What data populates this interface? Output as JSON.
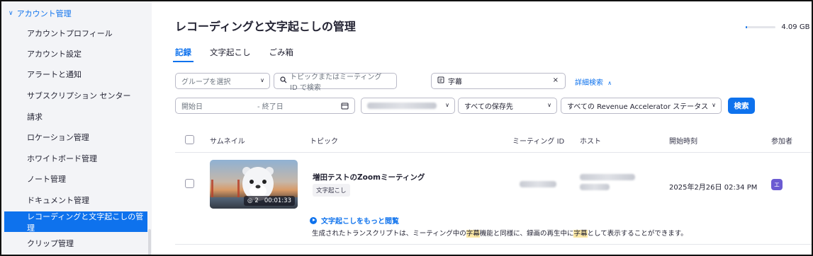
{
  "sidebar": {
    "section_label": "アカウント管理",
    "items": [
      {
        "label": "アカウントプロフィール",
        "active": false
      },
      {
        "label": "アカウント設定",
        "active": false
      },
      {
        "label": "アラートと通知",
        "active": false
      },
      {
        "label": "サブスクリプション センター",
        "active": false
      },
      {
        "label": "請求",
        "active": false
      },
      {
        "label": "ロケーション管理",
        "active": false
      },
      {
        "label": "ホワイトボード管理",
        "active": false
      },
      {
        "label": "ノート管理",
        "active": false
      },
      {
        "label": "ドキュメント管理",
        "active": false
      },
      {
        "label": "レコーディングと文字起こしの管理",
        "active": true
      },
      {
        "label": "クリップ管理",
        "active": false
      }
    ]
  },
  "page": {
    "title": "レコーディングと文字起こしの管理",
    "storage_label": "4.09 GB /",
    "storage_used_fraction": 0.05
  },
  "tabs": [
    {
      "label": "記録",
      "active": true
    },
    {
      "label": "文字起こし",
      "active": false
    },
    {
      "label": "ごみ箱",
      "active": false
    }
  ],
  "filters": {
    "group_select": "グループを選択",
    "search_placeholder": "トピックまたはミーティング ID で検索",
    "keyword_value": "字幕",
    "advanced_search": "詳細検索",
    "start_date_placeholder": "開始日",
    "end_date_placeholder": "- 終了日",
    "storage_select": "すべての保存先",
    "ra_status_select": "すべての Revenue Accelerator ステータス",
    "search_button": "検索"
  },
  "table": {
    "columns": [
      "サムネイル",
      "トピック",
      "ミーティング ID",
      "ホスト",
      "開始時刻",
      "参加者"
    ],
    "rows": [
      {
        "topic": "増田テストのZoomミーティング",
        "tag": "文字起こし",
        "views": "2",
        "duration": "00:01:33",
        "start_time": "2025年2月26日 02:34 PM",
        "avatar_initial": "エ",
        "more_link": "文字起こしをもっと閲覧",
        "snippet_pre": "生成されたトランスクリプトは、ミーティング中の",
        "snippet_hl1": "字幕",
        "snippet_mid": "機能と同様に、録画の再生中に",
        "snippet_hl2": "字幕",
        "snippet_post": "として表示することができます。"
      }
    ]
  },
  "colors": {
    "accent": "#0e72ed",
    "sidebar_bg": "#f3f4f7",
    "highlight": "#fde9a6",
    "avatar": "#6b5bd2"
  },
  "icons": {
    "section_toggle": "chevron-down-icon",
    "search": "search-icon",
    "keyword": "transcript-icon",
    "clear": "close-icon",
    "calendar": "calendar-icon",
    "play": "play-icon",
    "views": "eye-icon"
  }
}
